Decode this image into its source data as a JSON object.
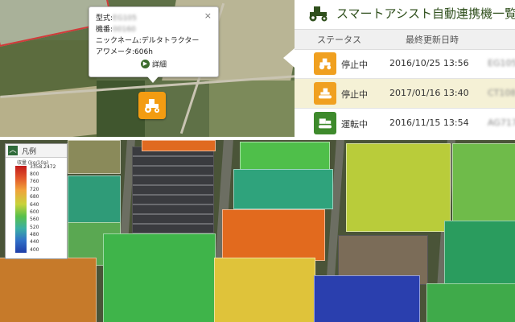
{
  "popup": {
    "model_label": "型式:",
    "model_value": "EG105",
    "serial_label": "機番:",
    "serial_value": "00160",
    "nickname": "ニックネーム:デルタトラクター",
    "hour_meter": "アワメータ:606h",
    "detail_label": "詳細",
    "close_glyph": "×"
  },
  "panel": {
    "title": "スマートアシスト自動連携機一覧",
    "columns": [
      "ステータス",
      "最終更新日時"
    ],
    "rows": [
      {
        "status": "停止中",
        "datetime": "2016/10/25 13:56",
        "id": "EG105",
        "icon": "tractor-icon",
        "color": "#f0a020"
      },
      {
        "status": "停止中",
        "datetime": "2017/01/16 13:40",
        "id": "CT108",
        "icon": "crawler-icon",
        "color": "#f0a020"
      },
      {
        "status": "運転中",
        "datetime": "2016/11/15 13:54",
        "id": "AG717",
        "icon": "combine-icon",
        "color": "#3e8a2c"
      }
    ]
  },
  "legend": {
    "title": "凡例",
    "unit": "収量 (kg/10a)",
    "ticks": [
      "3358.2472",
      "800",
      "760",
      "720",
      "680",
      "640",
      "600",
      "560",
      "520",
      "480",
      "440",
      "400"
    ]
  },
  "colors": {
    "brand_green": "#2f4f1c",
    "stopped": "#f0a020",
    "running": "#3e8a2c",
    "selected_row": "#f5f1d6"
  }
}
